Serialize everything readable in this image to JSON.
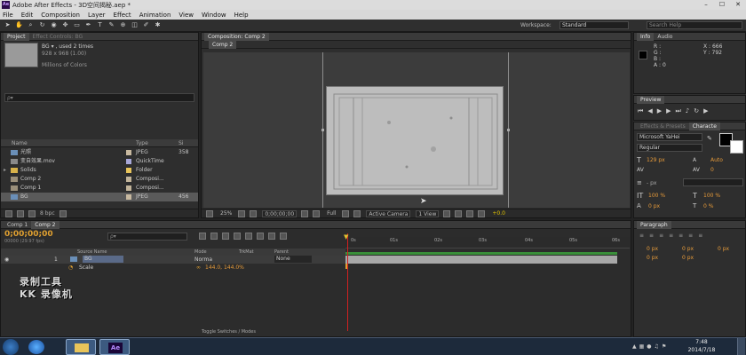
{
  "window": {
    "title": "Adobe After Effects - 3D空间揭秘.aep *",
    "min": "–",
    "max": "☐",
    "close": "✕"
  },
  "menu": [
    "File",
    "Edit",
    "Composition",
    "Layer",
    "Effect",
    "Animation",
    "View",
    "Window",
    "Help"
  ],
  "toolbar": {
    "workspace_label": "Workspace:",
    "workspace_value": "Standard",
    "search_placeholder": "Search Help"
  },
  "project": {
    "tabs": {
      "project": "Project",
      "effect_controls": "Effect Controls: BG"
    },
    "item_name": "BG ▾ , used 2 times",
    "item_dims": "928 x 968 (1.00)",
    "item_color": "Millions of Colors",
    "search_glyph": "ρ▾",
    "columns": {
      "name": "Name",
      "type": "Type",
      "size": "Si"
    },
    "rows": [
      {
        "name": "光照",
        "type": "JPEG",
        "size": "358",
        "color": "#c8b9a0",
        "icon": "#6a8fb8"
      },
      {
        "name": "变自效果.mov",
        "type": "QuickTime",
        "size": "",
        "color": "#a8a8d8",
        "icon": "#8a8a8a"
      },
      {
        "name": "Solids",
        "type": "Folder",
        "size": "",
        "color": "#e8c45a",
        "icon": "#d8b24a"
      },
      {
        "name": "Comp 2",
        "type": "Composi...",
        "size": "",
        "color": "#c2b49a",
        "icon": "#9a8f7a"
      },
      {
        "name": "Comp 1",
        "type": "Composi...",
        "size": "",
        "color": "#c2b49a",
        "icon": "#9a8f7a"
      },
      {
        "name": "BG",
        "type": "JPEG",
        "size": "456",
        "color": "#c8b9a0",
        "icon": "#6a8fb8"
      }
    ],
    "bpc": "8 bpc"
  },
  "composition": {
    "tab": "Composition: Comp 2",
    "subtab": "Comp 2",
    "zoom": "25%",
    "timecode": "0;00;00;00",
    "resolution": "Full",
    "camera": "Active Camera",
    "views": "1 View",
    "exposure": "+0.0"
  },
  "info": {
    "tabs": {
      "info": "Info",
      "audio": "Audio"
    },
    "r": "R :",
    "g": "G :",
    "b": "B :",
    "a": "A : 0",
    "x": "X : 666",
    "y": "Y : 792"
  },
  "preview": {
    "tab": "Preview"
  },
  "character": {
    "tabs": {
      "effects": "Effects & Presets",
      "character": "Characte"
    },
    "font": "Microsoft YaHei",
    "style": "Regular",
    "size": "129 px",
    "leading": "Auto",
    "tracking": "0",
    "stroke": "- px",
    "vscale": "100 %",
    "hscale": "100 %",
    "baseline": "0 px",
    "tsume": "0 %"
  },
  "timeline": {
    "tabs": {
      "comp1": "Comp 1",
      "comp2": "Comp 2"
    },
    "timecode": "0;00;00;00",
    "fps": "00000 (29.97 fps)",
    "search_glyph": "ρ▾",
    "cols": {
      "source": "Source Name",
      "mode": "Mode",
      "trkmat": "TrkMat",
      "parent": "Parent"
    },
    "layer": {
      "num": "1",
      "name": "BG",
      "mode": "Norma",
      "parent": "None"
    },
    "prop": {
      "name": "Scale",
      "value": "144.0, 144.0%"
    },
    "ticks": [
      "0s",
      "01s",
      "02s",
      "03s",
      "04s",
      "05s",
      "06s"
    ],
    "footer": "Toggle Switches / Modes"
  },
  "paragraph": {
    "tab": "Paragraph",
    "vals": [
      "0 px",
      "0 px",
      "0 px",
      "0 px",
      "0 px"
    ]
  },
  "watermark": {
    "line1": "录制工具",
    "line2": "KK 录像机"
  },
  "taskbar": {
    "time": "7:48",
    "date": "2014/7/18",
    "ae_label": "Ae"
  }
}
